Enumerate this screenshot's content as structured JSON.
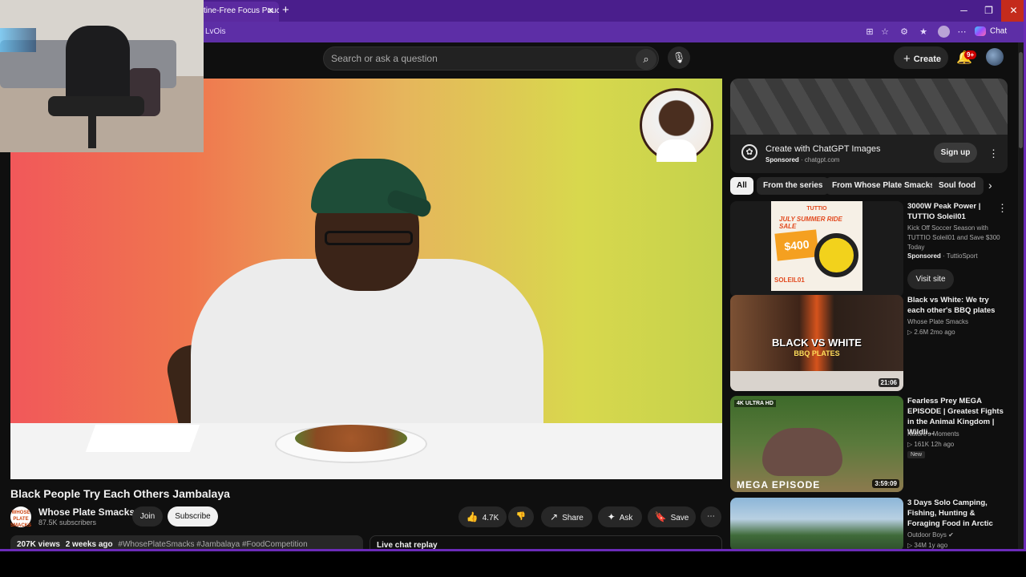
{
  "browser": {
    "tab_title": "tine-Free Focus Pouch",
    "url_fragment": "LvOis",
    "chat_label": "Chat"
  },
  "header": {
    "search_placeholder": "Search or ask a question",
    "create_label": "Create",
    "notification_badge": "9+"
  },
  "video": {
    "title": "Black People Try Each Others Jambalaya",
    "channel": {
      "name": "Whose Plate Smacks",
      "subscribers": "87.5K subscribers",
      "logo_text": "WHOSE PLATE SMACKS"
    },
    "join_label": "Join",
    "subscribe_label": "Subscribe",
    "actions": {
      "likes": "4.7K",
      "share": "Share",
      "ask": "Ask",
      "save": "Save"
    },
    "description": {
      "views": "207K views",
      "age": "2 weeks ago",
      "tags": "#WhosePlateSmacks #Jambalaya #FoodCompetition"
    },
    "live_chat_label": "Live chat replay"
  },
  "sidebar": {
    "ad": {
      "title": "Create with ChatGPT Images",
      "sponsored": "Sponsored",
      "domain": "chatgpt.com",
      "cta": "Sign up"
    },
    "chips": [
      "All",
      "From the series",
      "From Whose Plate Smacks",
      "Soul food"
    ],
    "items": [
      {
        "title": "3000W Peak Power | TUTTIO Soleil01",
        "description": "Kick Off Soccer Season with TUTTIO Soleil01 and Save $300 Today",
        "sponsored": "Sponsored",
        "channel": "TuttioSport",
        "cta": "Visit site",
        "poster_header": "TUTTIO",
        "poster_headline": "JULY SUMMER RIDE SALE",
        "poster_price": "$400",
        "poster_footer": "SOLEIL01"
      },
      {
        "title": "Black vs White: We try each other's BBQ plates",
        "channel": "Whose Plate Smacks",
        "views": "2.6M",
        "age": "2mo ago",
        "duration": "21:06",
        "thumb_text": "BLACK VS WHITE",
        "thumb_sub": "BBQ PLATES"
      },
      {
        "title": "Fearless Prey MEGA EPISODE | Greatest Fights in the Animal Kingdom | Wildli...",
        "channel": "Nature's Moments",
        "views": "161K",
        "age": "12h ago",
        "badge": "New",
        "duration": "3:59:09",
        "thumb_badge": "4K ULTRA HD",
        "thumb_text": "MEGA EPISODE"
      },
      {
        "title": "3 Days Solo Camping, Fishing, Hunting & Foraging Food in Arctic",
        "channel": "Outdoor Boys",
        "views": "34M",
        "age": "1y ago"
      }
    ]
  },
  "colors": {
    "browser_frame": "#6b2bb8",
    "youtube_bg": "#0f0f0f",
    "accent_red": "#cc0000"
  }
}
